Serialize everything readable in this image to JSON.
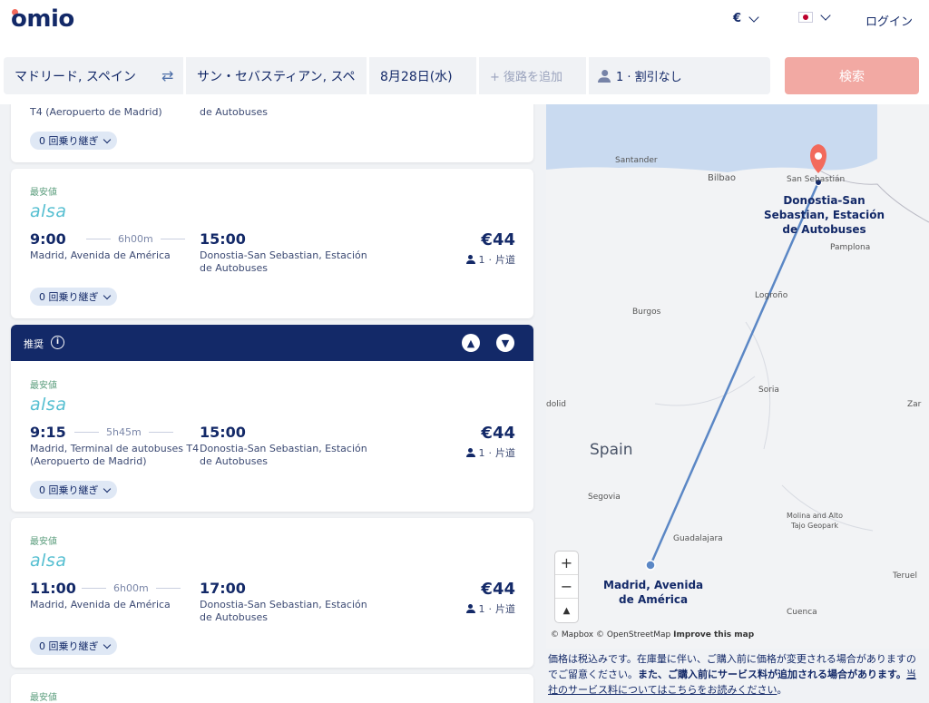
{
  "header": {
    "logo": "omio",
    "currency": "€",
    "login": "ログイン"
  },
  "search": {
    "origin": "マドリード, スペイン",
    "destination": "サン・セバスティアン, スペ",
    "date": "8月28日(水)",
    "return_placeholder": "+ 復路を追加",
    "passengers": "1 · 割引なし",
    "search_button": "検索"
  },
  "results": {
    "partial": {
      "station_from": "T4 (Aeropuerto de Madrid)",
      "station_to": "de Autobuses",
      "transfer": "0 回乗り継ぎ"
    },
    "cards": [
      {
        "badge": "最安値",
        "carrier": "alsa",
        "depart": "9:00",
        "duration": "6h00m",
        "arrive": "15:00",
        "from": "Madrid, Avenida de América",
        "to": "Donostia-San Sebastian, Estación de Autobuses",
        "price": "€44",
        "pax": "1",
        "trip": "片道",
        "transfer": "0 回乗り継ぎ"
      },
      {
        "badge": "最安値",
        "carrier": "alsa",
        "depart": "9:15",
        "duration": "5h45m",
        "arrive": "15:00",
        "from": "Madrid, Terminal de autobuses T4 (Aeropuerto de Madrid)",
        "to": "Donostia-San Sebastian, Estación de Autobuses",
        "price": "€44",
        "pax": "1",
        "trip": "片道",
        "transfer": "0 回乗り継ぎ"
      },
      {
        "badge": "最安値",
        "carrier": "alsa",
        "depart": "11:00",
        "duration": "6h00m",
        "arrive": "17:00",
        "from": "Madrid, Avenida de América",
        "to": "Donostia-San Sebastian, Estación de Autobuses",
        "price": "€44",
        "pax": "1",
        "trip": "片道",
        "transfer": "0 回乗り継ぎ"
      }
    ],
    "recommended_label": "推奨",
    "last_badge": "最安値"
  },
  "map": {
    "labels": {
      "santander": "Santander",
      "bilbao": "Bilbao",
      "san_sebastian": "San Sebastián",
      "pamplona": "Pamplona",
      "logrono": "Logroño",
      "burgos": "Burgos",
      "soria": "Soria",
      "valladolid": "dolid",
      "zar": "Zar",
      "spain": "Spain",
      "segovia": "Segovia",
      "guadalajara": "Guadalajara",
      "molina": "Molina and Alto",
      "molina2": "Tajo Geopark",
      "teruel": "Teruel",
      "cuenca": "Cuenca",
      "dest1": "Donostia-San",
      "dest2": "Sebastian, Estación",
      "dest3": "de Autobuses",
      "origin1": "Madrid, Avenida",
      "origin2": "de América"
    },
    "attribution": "© Mapbox © OpenStreetMap",
    "improve": "Improve this map",
    "colors": {
      "route": "#5b87c5",
      "marker": "#f26a5c",
      "sea": "#c9daf0"
    }
  },
  "disclaimer": {
    "text1": "価格は税込みです。在庫量に伴い、ご購入前に価格が変更される場合がありますのでご留意ください。",
    "bold": "また、ご購入前にサービス料が追加される場合があります。",
    "link": "当社のサービス料についてはこちらをお読みください",
    "end": "。"
  }
}
